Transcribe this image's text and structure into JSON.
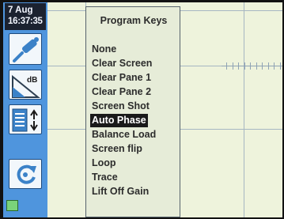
{
  "status": {
    "date": "7 Aug",
    "time": "16:37:35"
  },
  "sidebar": {
    "buttons": [
      {
        "name": "probe",
        "icon": "probe-icon"
      },
      {
        "name": "gain",
        "icon": "db-gain-icon",
        "label": "dB"
      },
      {
        "name": "scroll-list",
        "icon": "list-scroll-icon"
      },
      {
        "name": "refresh",
        "icon": "refresh-icon"
      }
    ]
  },
  "menu": {
    "title": "Program Keys",
    "selected_index": 5,
    "items": [
      "None",
      "Clear Screen",
      "Clear Pane 1",
      "Clear Pane 2",
      "Screen Shot",
      "Auto Phase",
      "Balance Load",
      "Screen flip",
      "Loop",
      "Trace",
      "Lift Off Gain"
    ]
  },
  "colors": {
    "sidebar": "#4f95dd",
    "screen_bg": "#eef3dc",
    "datetime_bg": "#1b2230",
    "selected_bg": "#1a1a1a",
    "battery": "#7ad37a"
  }
}
